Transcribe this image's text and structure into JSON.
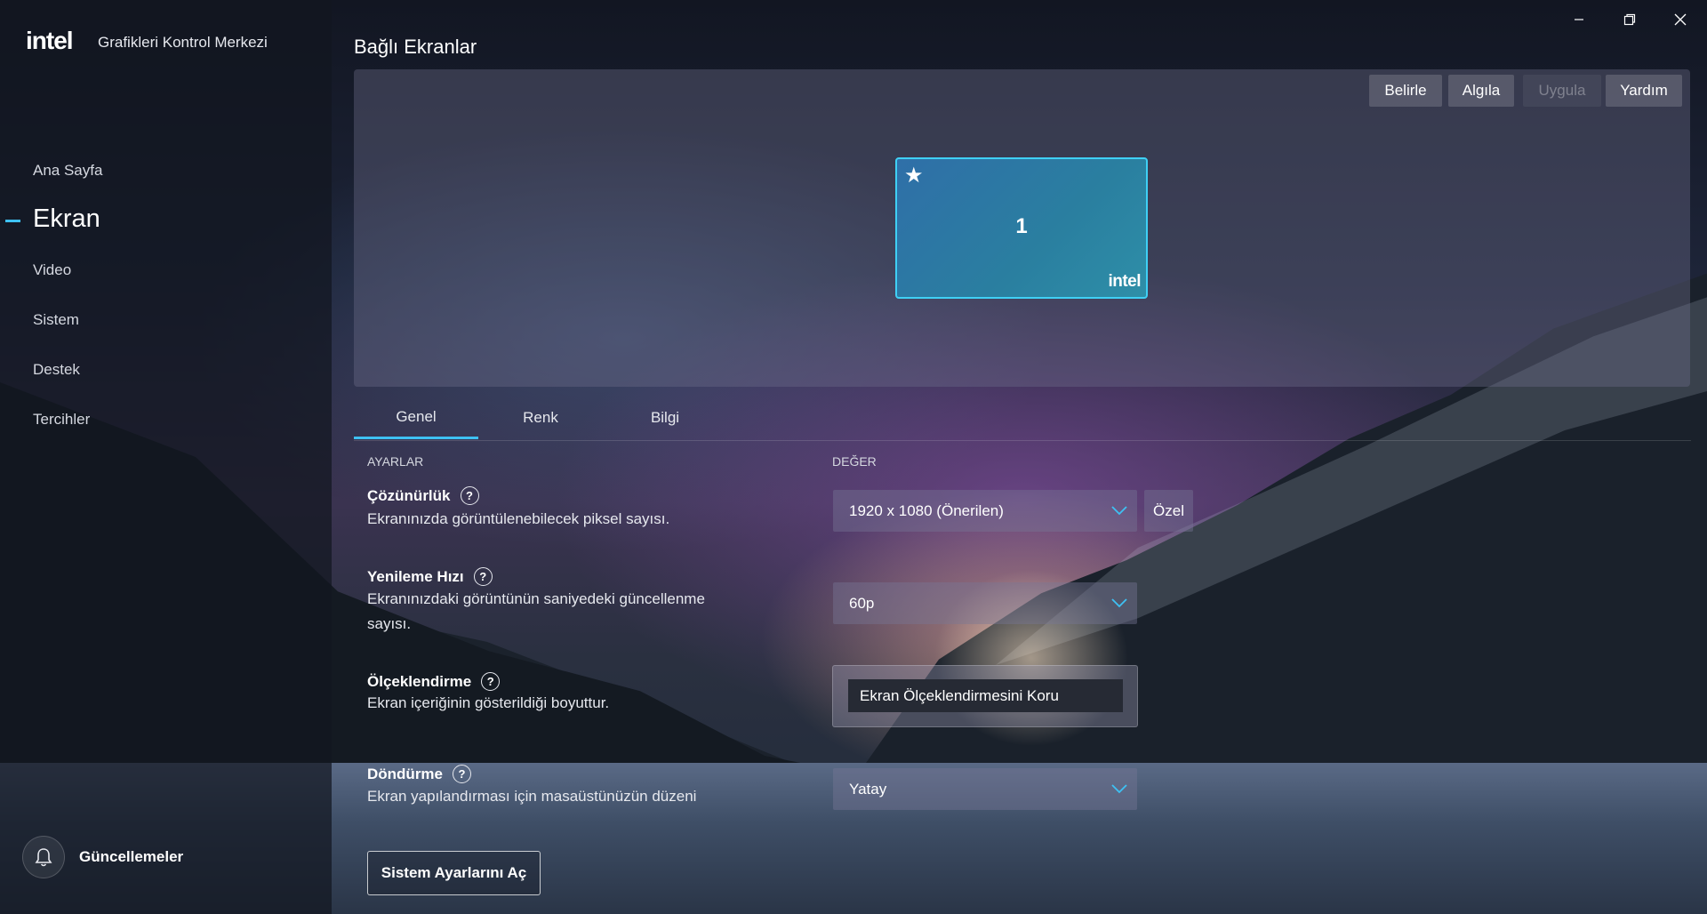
{
  "app": {
    "logo_text": "intel",
    "title": "Grafikleri Kontrol Merkezi"
  },
  "sidebar": {
    "items": [
      {
        "label": "Ana Sayfa",
        "active": false
      },
      {
        "label": "Ekran",
        "active": true
      },
      {
        "label": "Video",
        "active": false
      },
      {
        "label": "Sistem",
        "active": false
      },
      {
        "label": "Destek",
        "active": false
      },
      {
        "label": "Tercihler",
        "active": false
      }
    ],
    "updates_label": "Güncellemeler",
    "updates_icon": "bell-icon"
  },
  "window_controls": [
    "minimize-icon",
    "restore-icon",
    "close-icon"
  ],
  "main": {
    "title": "Bağlı Ekranlar",
    "toolbar": {
      "identify": "Belirle",
      "detect": "Algıla",
      "apply": "Uygula",
      "help": "Yardım"
    },
    "monitor": {
      "number": "1",
      "primary_icon": "star-icon",
      "brand": "intel"
    },
    "tabs": [
      {
        "label": "Genel",
        "active": true
      },
      {
        "label": "Renk",
        "active": false
      },
      {
        "label": "Bilgi",
        "active": false
      }
    ],
    "columns": {
      "settings": "AYARLAR",
      "value": "DEĞER"
    },
    "settings": {
      "resolution": {
        "title": "Çözünürlük",
        "desc": "Ekranınızda görüntülenebilecek piksel sayısı.",
        "value": "1920 x 1080 (Önerilen)",
        "custom_button": "Özel"
      },
      "refresh": {
        "title": "Yenileme Hızı",
        "desc": "Ekranınızdaki görüntünün saniyedeki güncellenme sayısı.",
        "value": "60p"
      },
      "scaling": {
        "title": "Ölçeklendirme",
        "desc": "Ekran içeriğinin gösterildiği boyuttur.",
        "value": "Ekran Ölçeklendirmesini Koru"
      },
      "rotation": {
        "title": "Döndürme",
        "desc": "Ekran yapılandırması için masaüstünüzün düzeni",
        "value": "Yatay"
      }
    },
    "system_settings_button": "Sistem Ayarlarını Aç"
  },
  "colors": {
    "accent": "#3ec1f3",
    "monitor_fill": "#2f7aa6"
  }
}
